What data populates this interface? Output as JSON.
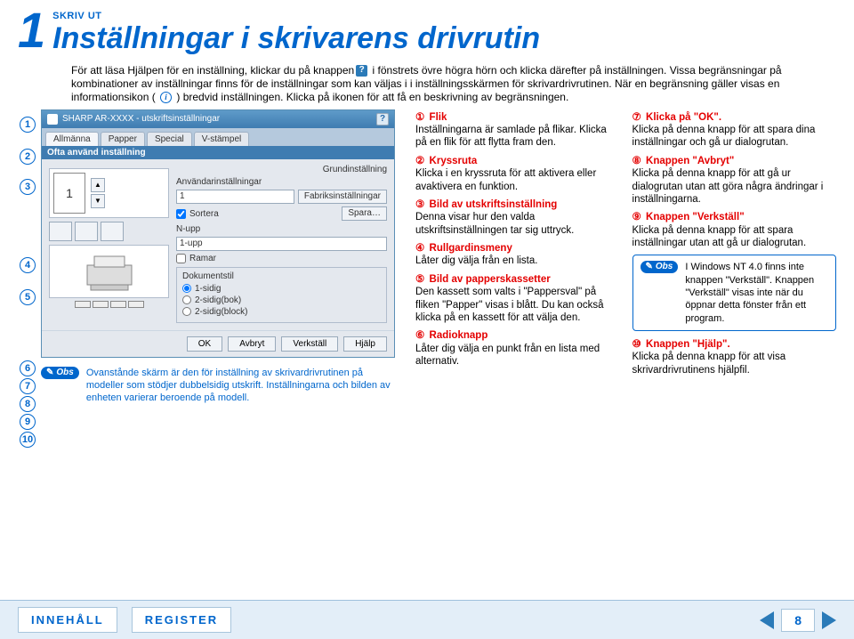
{
  "chapter_number": "1",
  "breadcrumb": "SKRIV UT",
  "title": "Inställningar i skrivarens drivrutin",
  "intro_part1": "För att läsa Hjälpen för en inställning, klickar du på knappen",
  "intro_part2": " i fönstrets övre högra hörn och klicka därefter på inställningen. Vissa begränsningar på kombinationer av inställningar finns för de inställningar som kan väljas i i inställningsskärmen för skrivardrivrutinen. När en begränsning gäller visas en informationsikon ( ",
  "intro_part3": " ) bredvid inställningen. Klicka på ikonen för att få en beskrivning av begränsningen.",
  "dialog": {
    "title": "SHARP AR-XXXX  - utskriftsinställningar",
    "tabs": [
      "Allmänna",
      "Papper",
      "Special",
      "V-stämpel"
    ],
    "section_label": "Ofta använd inställning",
    "page_thumb_text": "1",
    "grundinst": "Grundinställning",
    "user_settings_label": "Användarinställningar",
    "user_settings_value": "1",
    "fabriks_btn": "Fabriksinställningar",
    "sortera_label": "Sortera",
    "spara_btn": "Spara…",
    "nupp_label": "N-upp",
    "nupp_value": "1-upp",
    "ramar_label": "Ramar",
    "doc_title": "Dokumentstil",
    "radios": [
      "1-sidig",
      "2-sidig(bok)",
      "2-sidig(block)"
    ],
    "footer_buttons": [
      "OK",
      "Avbryt",
      "Verkställ",
      "Hjälp"
    ]
  },
  "obs_label": "Obs",
  "shot_caption": "Ovanstånde skärm är den för inställning av skrivardrivrutinen på modeller som stödjer dubbelsidig utskrift.\nInställningarna och bilden av enheten varierar beroende på modell.",
  "markers": [
    "1",
    "2",
    "3",
    "4",
    "5",
    "6",
    "7",
    "8",
    "9",
    "10"
  ],
  "circled": [
    "①",
    "②",
    "③",
    "④",
    "⑤",
    "⑥",
    "⑦",
    "⑧",
    "⑨",
    "⑩"
  ],
  "mid_items": [
    {
      "head": "Flik",
      "body": "Inställningarna är samlade på flikar. Klicka på en flik för att flytta fram den."
    },
    {
      "head": "Kryssruta",
      "body": "Klicka i en kryssruta för att aktivera eller avaktivera en funktion."
    },
    {
      "head": "Bild av utskriftsinställning",
      "body": "Denna visar hur den valda utskriftsinställningen tar sig uttryck."
    },
    {
      "head": "Rullgardinsmeny",
      "body": "Låter dig välja från en lista."
    },
    {
      "head": "Bild av papperskassetter",
      "body": "Den kassett som valts i \"Pappersval\" på fliken \"Papper\" visas i blått. Du kan också klicka på en kassett för att välja den."
    },
    {
      "head": "Radioknapp",
      "body": "Låter dig välja en punkt från en lista med alternativ."
    }
  ],
  "right_items": [
    {
      "head": "Klicka på \"OK\".",
      "body": "Klicka på denna knapp för att spara dina inställningar och gå ur dialogrutan."
    },
    {
      "head": "Knappen \"Avbryt\"",
      "body": "Klicka på denna knapp för att gå ur dialogrutan utan att göra några ändringar i inställningarna."
    },
    {
      "head": "Knappen \"Verkställ\"",
      "body": "Klicka på denna knapp för att spara inställningar utan att gå ur dialogrutan."
    }
  ],
  "note_text": "I Windows NT 4.0 finns inte knappen \"Verkställ\".\nKnappen \"Verkställ\" visas inte när du öppnar detta fönster från ett program.",
  "right_item10": {
    "head": "Knappen \"Hjälp\".",
    "body": "Klicka på denna knapp för att visa skrivardrivrutinens hjälpfil."
  },
  "footer": {
    "contents": "INNEHÅLL",
    "register": "REGISTER",
    "page": "8"
  }
}
